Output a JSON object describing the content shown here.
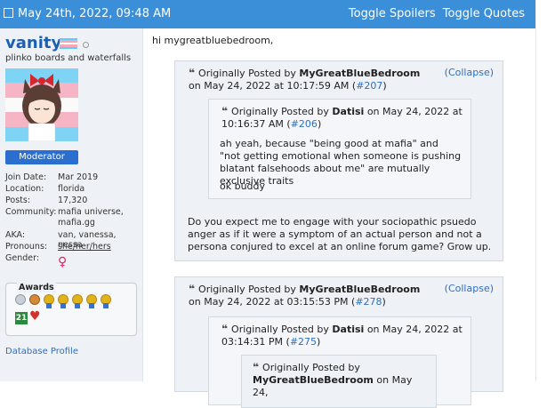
{
  "topbar": {
    "date": "May 24th, 2022, 09:48 AM",
    "toggle_spoilers": "Toggle Spoilers",
    "toggle_quotes": "Toggle Quotes"
  },
  "user": {
    "name": "vanity.",
    "title": "plinko boards and waterfalls",
    "badge": "Moderator",
    "info": [
      {
        "key": "Join Date:",
        "value": "Mar 2019"
      },
      {
        "key": "Location:",
        "value": "florida"
      },
      {
        "key": "Posts:",
        "value": "17,320"
      },
      {
        "key": "Community:",
        "value": "mafia universe, mafia.gg"
      },
      {
        "key": "AKA:",
        "value": "van, vanessa, nessa"
      },
      {
        "key": "Pronouns:",
        "value": "she/her/hers"
      },
      {
        "key": "Gender:",
        "value": ""
      }
    ],
    "gender_symbol": "♀",
    "awards_label": "Awards",
    "award_badge": "21",
    "heart": "♥",
    "database_profile": "Database Profile"
  },
  "post": {
    "greeting": "hi mygreatbluebedroom,",
    "quote1": {
      "prefix": "Originally Posted by",
      "author": "MyGreatBlueBedroom",
      "on": "on May 24,",
      "datetime": "2022 at 10:17:59 AM",
      "link": "#207",
      "collapse": "(Collapse)",
      "nested": {
        "prefix": "Originally Posted by",
        "author": "Datisi",
        "on": "on May 24, 2022 at",
        "datetime": "10:16:37 AM",
        "link": "#206",
        "text1": "ah yeah, because \"being good at mafia\" and \"not getting emotional when someone is pushing blatant falsehoods about me\" are mutually exclusive traits",
        "text2": "ok buddy"
      },
      "reply": "Do you expect me to engage with your sociopathic psuedo anger as if it were a symptom of an actual person and not a persona conjured to excel at an online forum game? Grow up."
    },
    "quote2": {
      "prefix": "Originally Posted by",
      "author": "MyGreatBlueBedroom",
      "on": "on May 24,",
      "datetime": "2022 at 03:15:53 PM",
      "link": "#278",
      "collapse": "(Collapse)",
      "nested": {
        "prefix": "Originally Posted by",
        "author": "Datisi",
        "on": "on May 24, 2022 at",
        "datetime": "03:14:31 PM",
        "link": "#275",
        "inner": {
          "prefix": "Originally Posted by",
          "author": "MyGreatBlueBedroom",
          "on": "on May 24,"
        }
      }
    }
  },
  "colors": {
    "header_bar": "#3a8fd8",
    "link": "#2d6fc0",
    "sidebar": "#eef1f5",
    "moderator_badge": "#2a6fd0"
  }
}
